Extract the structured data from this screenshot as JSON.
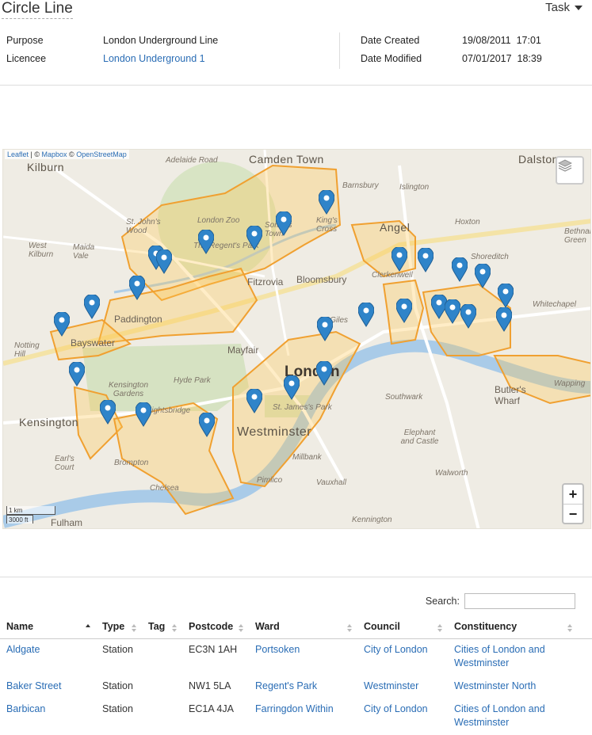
{
  "header": {
    "title": "Circle Line",
    "task_label": "Task"
  },
  "meta": {
    "purpose_label": "Purpose",
    "purpose_value": "London Underground Line",
    "licencee_label": "Licencee",
    "licencee_value": "London Underground 1",
    "date_created_label": "Date Created",
    "date_created_value": "19/08/2011  17:01",
    "date_modified_label": "Date Modified",
    "date_modified_value": "07/01/2017  18:39"
  },
  "map": {
    "attribution": {
      "leaflet": "Leaflet",
      "sep1": " | © ",
      "mapbox": "Mapbox",
      "sep2": " © ",
      "osm": "OpenStreetMap"
    },
    "zoom_in": "+",
    "zoom_out": "−",
    "scale_km": "1 km",
    "scale_ft": "3000 ft",
    "places": {
      "kilburn": "Kilburn",
      "camden_town": "Camden Town",
      "dalston": "Dalston",
      "angel": "Angel",
      "london": "London",
      "westminster": "Westminster",
      "kensington": "Kensington",
      "london_zoo": "London Zoo",
      "regents_park": "The Regent's Park",
      "bloomsbury": "Bloomsbury",
      "fitzrovia": "Fitzrovia",
      "mayfair": "Mayfair",
      "hyde_park": "Hyde Park",
      "kensington_gardens": "Kensington Gardens",
      "knightsbridge": "Knightsbridge",
      "brompton": "Brompton",
      "chelsea": "Chelsea",
      "pimlico": "Pimlico",
      "millbank": "Millbank",
      "vauxhall": "Vauxhall",
      "southwark": "Southwark",
      "elephant_castle": "Elephant and Castle",
      "walworth": "Walworth",
      "kennington": "Kennington",
      "butlers_wharf": "Butler's Wharf",
      "wapping": "Wapping",
      "whitechapel": "Whitechapel",
      "shoreditch": "Shoreditch",
      "hoxton": "Hoxton",
      "islington": "Islington",
      "barnsbury": "Barnsbury",
      "st_giles": "St Giles",
      "paddington": "Paddington",
      "bayswater": "Bayswater",
      "maida_vale": "Maida Vale",
      "west_kilburn": "West Kilburn",
      "st_johns_wood": "St. John's Wood",
      "somers_town": "Somers Town",
      "kings_cross": "King's Cross",
      "notting_hill": "Notting Hill",
      "earls_court": "Earl's Court",
      "st_james_park": "St. James's Park",
      "clerkenwell": "Clerkenwell",
      "bethnal_green": "Bethnal Green",
      "fulham": "Fulham",
      "adelaide_road": "Adelaide Road"
    }
  },
  "search": {
    "label": "Search:",
    "value": ""
  },
  "table": {
    "columns": [
      "Name",
      "Type",
      "Tag",
      "Postcode",
      "Ward",
      "Council",
      "Constituency"
    ],
    "rows": [
      {
        "name": "Aldgate",
        "type": "Station",
        "tag": "",
        "postcode": "EC3N 1AH",
        "ward": "Portsoken",
        "council": "City of London",
        "constituency": "Cities of London and Westminster"
      },
      {
        "name": "Baker Street",
        "type": "Station",
        "tag": "",
        "postcode": "NW1 5LA",
        "ward": "Regent's Park",
        "council": "Westminster",
        "constituency": "Westminster North"
      },
      {
        "name": "Barbican",
        "type": "Station",
        "tag": "",
        "postcode": "EC1A 4JA",
        "ward": "Farringdon Within",
        "council": "City of London",
        "constituency": "Cities of London and Westminster"
      }
    ]
  }
}
